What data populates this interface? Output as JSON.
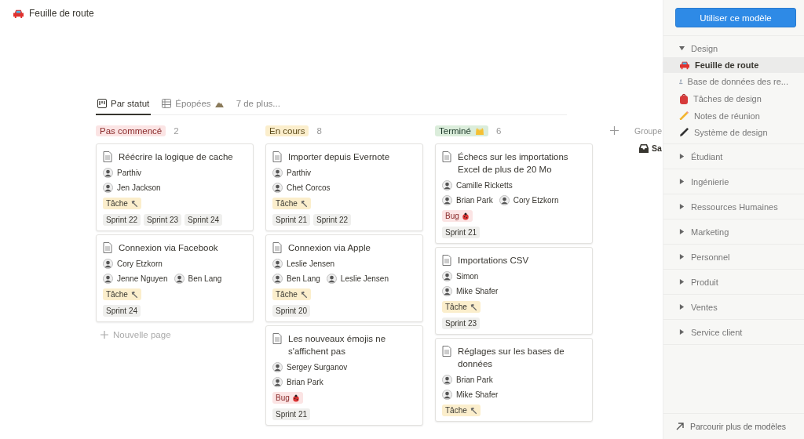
{
  "page": {
    "title": "Feuille de route"
  },
  "views": [
    {
      "label": "Par statut",
      "selected": true,
      "kind": "board"
    },
    {
      "label": "Épopées",
      "selected": false,
      "kind": "table"
    },
    {
      "label": "7 de plus...",
      "selected": false,
      "kind": "more"
    }
  ],
  "columns": [
    {
      "label": "Pas commencé",
      "count": "2",
      "kind": "not_started",
      "cards": [
        {
          "title": "Réécrire la logique de cache",
          "people": [
            [
              "Parthiv"
            ],
            [
              "Jen Jackson"
            ]
          ],
          "tags": [
            {
              "label": "Tâche",
              "kind": "task"
            }
          ],
          "sprints": [
            "Sprint 22",
            "Sprint 23",
            "Sprint 24"
          ]
        },
        {
          "title": "Connexion via Facebook",
          "people": [
            [
              "Cory Etzkorn"
            ],
            [
              "Jenne Nguyen",
              "Ben Lang"
            ]
          ],
          "tags": [
            {
              "label": "Tâche",
              "kind": "task"
            }
          ],
          "sprints": [
            "Sprint 24"
          ]
        }
      ],
      "new_page": "Nouvelle page"
    },
    {
      "label": "En cours",
      "count": "8",
      "kind": "in_progress",
      "cards": [
        {
          "title": "Importer depuis Evernote",
          "people": [
            [
              "Parthiv"
            ],
            [
              "Chet Corcos"
            ]
          ],
          "tags": [
            {
              "label": "Tâche",
              "kind": "task"
            }
          ],
          "sprints": [
            "Sprint 21",
            "Sprint 22"
          ]
        },
        {
          "title": "Connexion via Apple",
          "people": [
            [
              "Leslie Jensen"
            ],
            [
              "Ben Lang",
              "Leslie Jensen"
            ]
          ],
          "tags": [
            {
              "label": "Tâche",
              "kind": "task"
            }
          ],
          "sprints": [
            "Sprint 20"
          ]
        },
        {
          "title": "Les nouveaux émojis ne s'affichent pas",
          "people": [
            [
              "Sergey Surganov"
            ],
            [
              "Brian Park"
            ]
          ],
          "tags": [
            {
              "label": "Bug",
              "kind": "bug"
            }
          ],
          "sprints": [
            "Sprint 21"
          ]
        }
      ]
    },
    {
      "label": "Terminé",
      "count": "6",
      "kind": "done",
      "cards": [
        {
          "title": "Échecs sur les importations Excel de plus de 20 Mo",
          "people": [
            [
              "Camille Ricketts"
            ],
            [
              "Brian Park",
              "Cory Etzkorn"
            ]
          ],
          "tags": [
            {
              "label": "Bug",
              "kind": "bug"
            }
          ],
          "sprints": [
            "Sprint 21"
          ]
        },
        {
          "title": "Importations CSV",
          "people": [
            [
              "Simon"
            ],
            [
              "Mike Shafer"
            ]
          ],
          "tags": [
            {
              "label": "Tâche",
              "kind": "task"
            }
          ],
          "sprints": [
            "Sprint 23"
          ]
        },
        {
          "title": "Réglages sur les bases de données",
          "people": [
            [
              "Brian Park"
            ],
            [
              "Mike Shafer"
            ]
          ],
          "tags": [
            {
              "label": "Tâche",
              "kind": "task"
            }
          ]
        }
      ]
    }
  ],
  "hidden_groups": {
    "label": "Groupe",
    "items": [
      "Sa"
    ]
  },
  "sidebar": {
    "button": "Utiliser ce modèle",
    "groups": [
      {
        "label": "Design",
        "expanded": true,
        "children": [
          {
            "label": "Feuille de route",
            "selected": true
          },
          {
            "label": "Base de données des re...",
            "selected": false
          },
          {
            "label": "Tâches de design",
            "selected": false
          },
          {
            "label": "Notes de réunion",
            "selected": false
          },
          {
            "label": "Système de design",
            "selected": false
          }
        ]
      },
      {
        "label": "Étudiant",
        "expanded": false
      },
      {
        "label": "Ingénierie",
        "expanded": false
      },
      {
        "label": "Ressources Humaines",
        "expanded": false
      },
      {
        "label": "Marketing",
        "expanded": false
      },
      {
        "label": "Personnel",
        "expanded": false
      },
      {
        "label": "Produit",
        "expanded": false
      },
      {
        "label": "Ventes",
        "expanded": false
      },
      {
        "label": "Service client",
        "expanded": false
      }
    ],
    "footer": "Parcourir plus de modèles"
  }
}
